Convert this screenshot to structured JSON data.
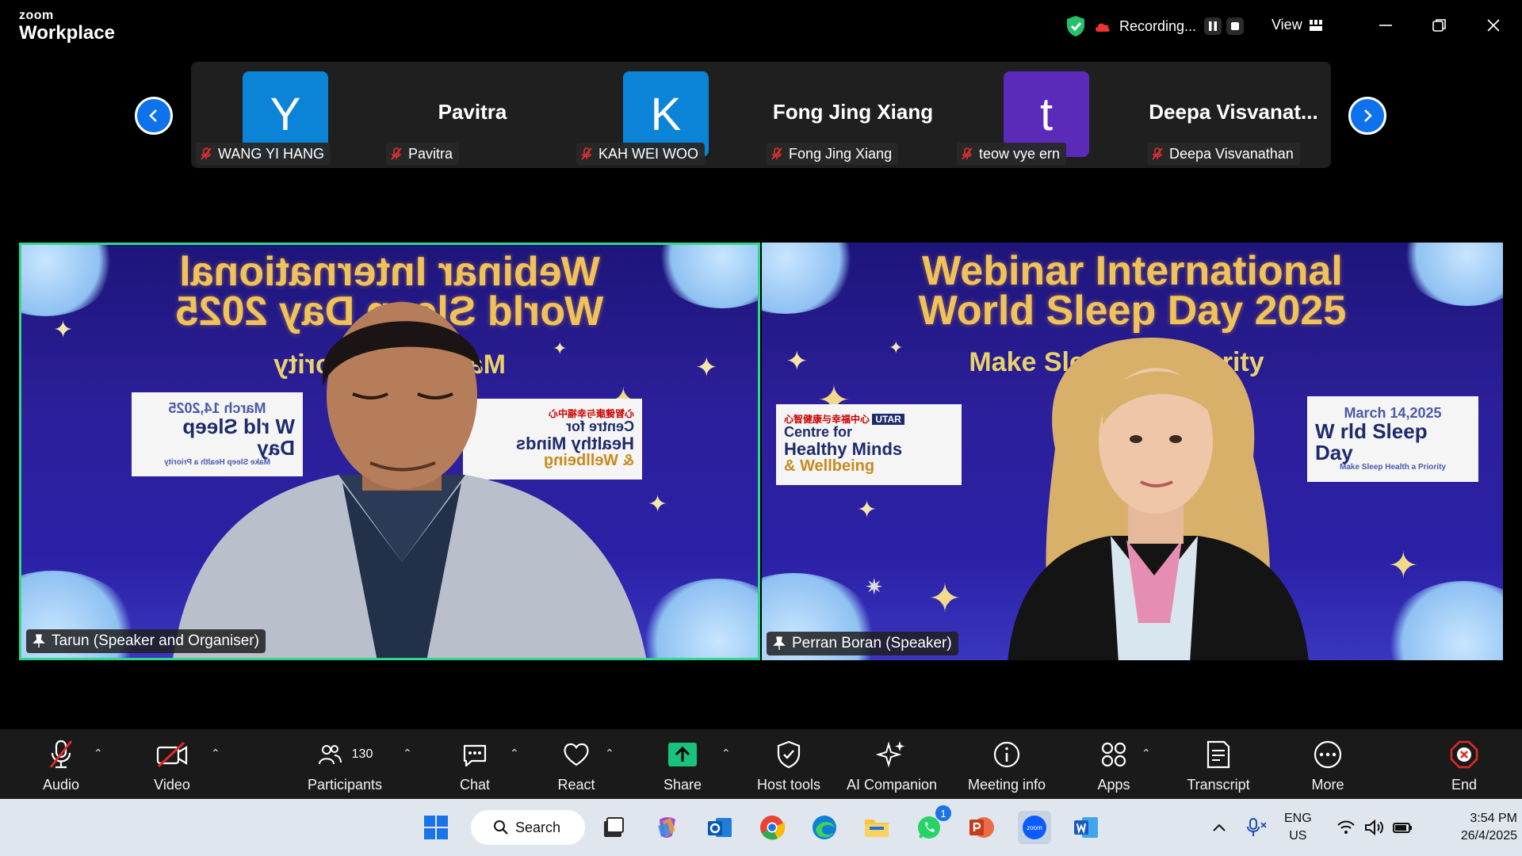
{
  "app": {
    "brand_small": "zoom",
    "brand_large": "Workplace"
  },
  "recording": {
    "label": "Recording..."
  },
  "view": {
    "label": "View"
  },
  "participants_strip": [
    {
      "label": "WANG YI HANG",
      "avatar_letter": "Y",
      "avatar_color": "#0b84d8"
    },
    {
      "label": "Pavitra",
      "big_name": "Pavitra"
    },
    {
      "label": "KAH WEI WOO",
      "avatar_letter": "K",
      "avatar_color": "#0b84d8"
    },
    {
      "label": "Fong Jing Xiang",
      "big_name": "Fong Jing Xiang"
    },
    {
      "label": "teow vye ern",
      "avatar_letter": "t",
      "avatar_color": "#5b2ab8"
    },
    {
      "label": "Deepa Visvanathan",
      "big_name": "Deepa  Visvanat..."
    }
  ],
  "banner": {
    "title_line1": "Webinar International",
    "title_line2": "World Sleep Day 2025",
    "subtitle_left": "Make Slee Priority",
    "subtitle_right": "Make Sleep h a Priority",
    "wsd_date": "March 14,2025",
    "wsd_name_left": "W rld Sleep Day",
    "wsd_name_right": "W rld Sleep Day",
    "wsd_tag": "Make Sleep Health a Priority",
    "utar": "UTAR",
    "centre_line1": "Centre for",
    "centre_line2": "Healthy Minds",
    "centre_line3": "& Wellbeing",
    "centre_cn": "心智健康与幸福中心"
  },
  "video_tiles": {
    "left_name": "Tarun (Speaker and Organiser)",
    "right_name": "Perran Boran (Speaker)"
  },
  "toolbar": {
    "audio": "Audio",
    "video": "Video",
    "participants": "Participants",
    "participants_count": "130",
    "chat": "Chat",
    "react": "React",
    "share": "Share",
    "host_tools": "Host tools",
    "ai_companion": "AI Companion",
    "meeting_info": "Meeting info",
    "apps": "Apps",
    "transcript": "Transcript",
    "more": "More",
    "end": "End"
  },
  "taskbar": {
    "search": "Search",
    "whatsapp_badge": "1",
    "lang1": "ENG",
    "lang2": "US",
    "time": "3:54 PM",
    "date": "26/4/2025"
  },
  "colors": {
    "accent": "#0e72ed",
    "active_speaker": "#2fd88b",
    "share_green": "#19c37d",
    "end_red": "#e02828"
  }
}
